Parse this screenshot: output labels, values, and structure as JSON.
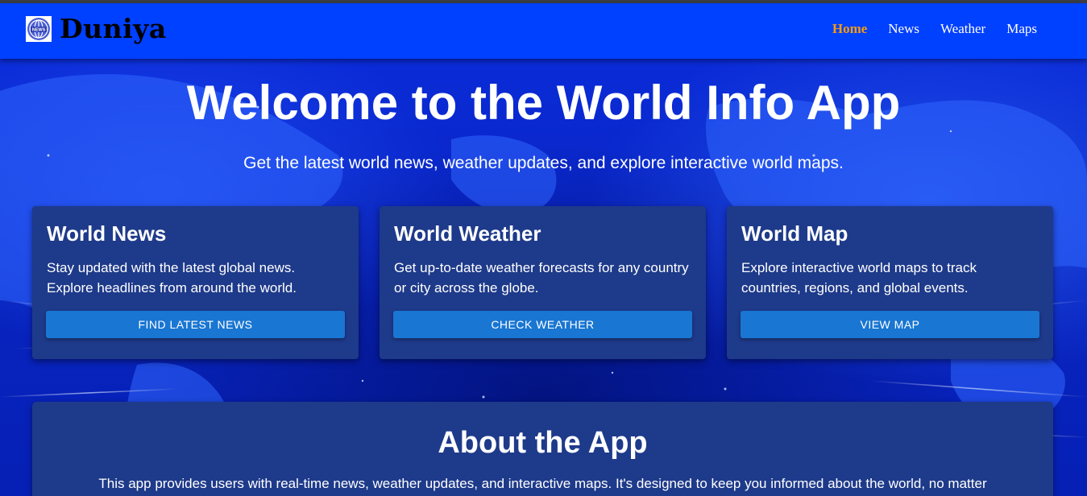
{
  "brand": {
    "name": "Duniya",
    "logo_icon": "globe-news-icon",
    "logo_badge": "NEWS"
  },
  "nav": {
    "items": [
      {
        "label": "Home",
        "active": true
      },
      {
        "label": "News",
        "active": false
      },
      {
        "label": "Weather",
        "active": false
      },
      {
        "label": "Maps",
        "active": false
      }
    ]
  },
  "hero": {
    "title": "Welcome to the World Info App",
    "subtitle": "Get the latest world news, weather updates, and explore interactive world maps."
  },
  "cards": [
    {
      "title": "World News",
      "description": "Stay updated with the latest global news. Explore headlines from around the world.",
      "button": "FIND LATEST NEWS"
    },
    {
      "title": "World Weather",
      "description": "Get up-to-date weather forecasts for any country or city across the globe.",
      "button": "CHECK WEATHER"
    },
    {
      "title": "World Map",
      "description": "Explore interactive world maps to track countries, regions, and global events.",
      "button": "VIEW MAP"
    }
  ],
  "about": {
    "title": "About the App",
    "text": "This app provides users with real-time news, weather updates, and interactive maps. It's designed to keep you informed about the world, no matter"
  },
  "colors": {
    "navbar": "#0040ff",
    "active_link": "#f39c12",
    "card_bg": "#1e3a8a",
    "button_bg": "#1976d2"
  }
}
